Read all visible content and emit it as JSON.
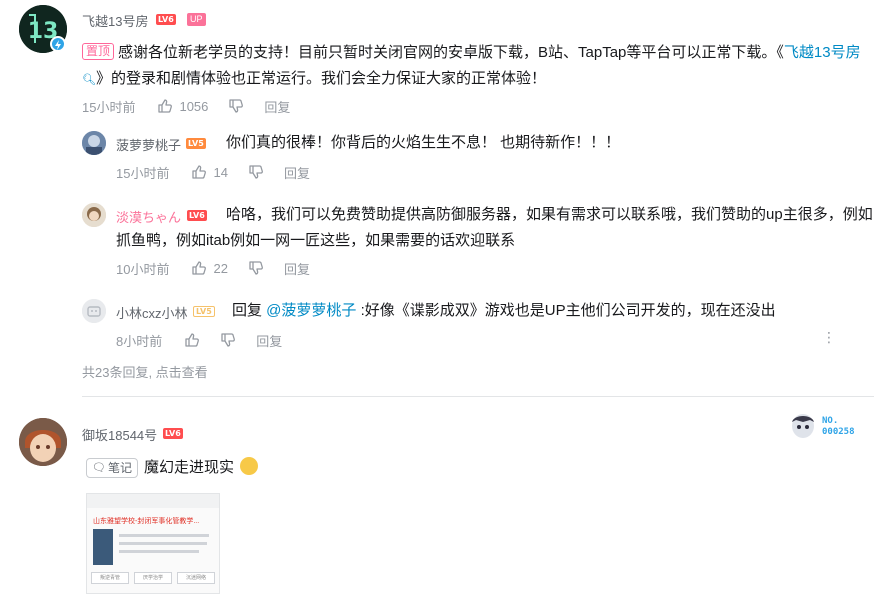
{
  "comment1": {
    "username": "飞越13号房",
    "level": "LV6",
    "up_badge": "UP",
    "pin_label": "置顶",
    "text_before": "感谢各位新老学员的支持！目前只暂时关闭官网的安卓版下载，B站、TapTap等平台可以正常下载。《",
    "game_link": "飞越13号房",
    "text_after": "》的登录和剧情体验也正常运行。我们会全力保证大家的正常体验！",
    "time": "15小时前",
    "likes": "1056",
    "reply_label": "回复",
    "replies": [
      {
        "username": "菠萝萝桃子",
        "level": "LV5",
        "text": "你们真的很棒！你背后的火焰生生不息！ 也期待新作！！！",
        "time": "15小时前",
        "likes": "14",
        "reply_label": "回复"
      },
      {
        "username": "淡漠ちゃん",
        "level": "LV6",
        "text": "哈咯，我们可以免费赞助提供高防御服务器，如果有需求可以联系哦，我们赞助的up主很多，例如抓鱼鸭，例如itab例如一网一匠这些，如果需要的话欢迎联系",
        "time": "10小时前",
        "likes": "22",
        "reply_label": "回复"
      },
      {
        "username": "小林cxz小林",
        "level": "LV5",
        "reply_prefix": "回复 ",
        "mention": "@菠萝萝桃子",
        "text": " :好像《谍影成双》游戏也是UP主他们公司开发的，现在还没出",
        "time": "8小时前",
        "likes": "",
        "reply_label": "回复"
      }
    ],
    "footer": "共23条回复, 点击查看"
  },
  "comment2": {
    "username": "御坂18544号",
    "level": "LV6",
    "note_tag": "笔记",
    "text": "魔幻走进现实",
    "fan_card_no": "NO.",
    "fan_card_number": "000258",
    "thumbnail": {
      "title": "山东雅望学校-封闭军事化管教学...",
      "buttons": [
        "叛逆青管",
        "厌学治学",
        "沉迷网络"
      ]
    }
  },
  "icons": {
    "like": "thumbs-up-icon",
    "dislike": "thumbs-down-icon",
    "more": "more-vertical-icon",
    "search": "search-icon",
    "verified": "lightning-badge-icon"
  },
  "colors": {
    "link": "#008ac5",
    "pink": "#fb7299",
    "meta": "#9499a0",
    "level_red": "#ff4d4f",
    "level_orange": "#ff8a3d"
  }
}
